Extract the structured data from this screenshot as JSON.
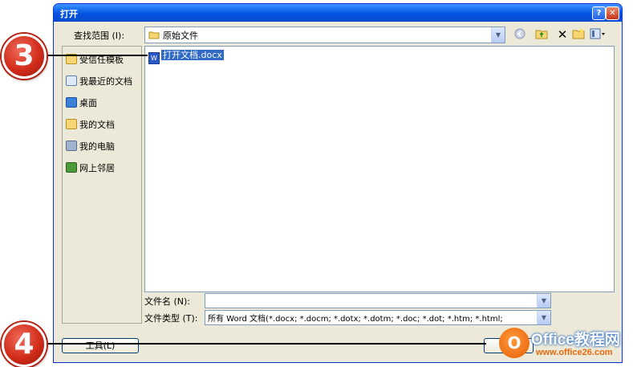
{
  "window": {
    "title": "打开"
  },
  "lookin": {
    "label": "查找范围 (I):",
    "value": "原始文件"
  },
  "toolbar": {
    "icons": [
      "back-icon",
      "up-folder-icon",
      "delete-icon",
      "new-folder-icon",
      "views-icon"
    ]
  },
  "places": {
    "items": [
      {
        "label": "受信任模板",
        "icon": "folder-icon"
      },
      {
        "label": "我最近的文档",
        "icon": "recent-docs-icon"
      },
      {
        "label": "桌面",
        "icon": "desktop-icon"
      },
      {
        "label": "我的文档",
        "icon": "my-documents-icon"
      },
      {
        "label": "我的电脑",
        "icon": "my-computer-icon"
      },
      {
        "label": "网上邻居",
        "icon": "network-icon"
      }
    ]
  },
  "filelist": {
    "items": [
      {
        "name": "打开文档.docx",
        "selected": true
      }
    ]
  },
  "filename": {
    "label": "文件名 (N):",
    "value": ""
  },
  "filetype": {
    "label": "文件类型 (T):",
    "value": "所有 Word 文档(*.docx; *.docm; *.dotx; *.dotm; *.doc; *.dot; *.htm; *.html;"
  },
  "buttons": {
    "tools_label": "工具(L)"
  },
  "callouts": {
    "step3": "3",
    "step4": "4"
  },
  "watermark": {
    "logo": "O",
    "brand": "Office教程网",
    "url": "www.office26.com"
  },
  "colors": {
    "titlebar": "#0a5fe8",
    "selection": "#316ac5",
    "callout": "#d22d1b",
    "dialog_bg": "#ece9d8"
  }
}
